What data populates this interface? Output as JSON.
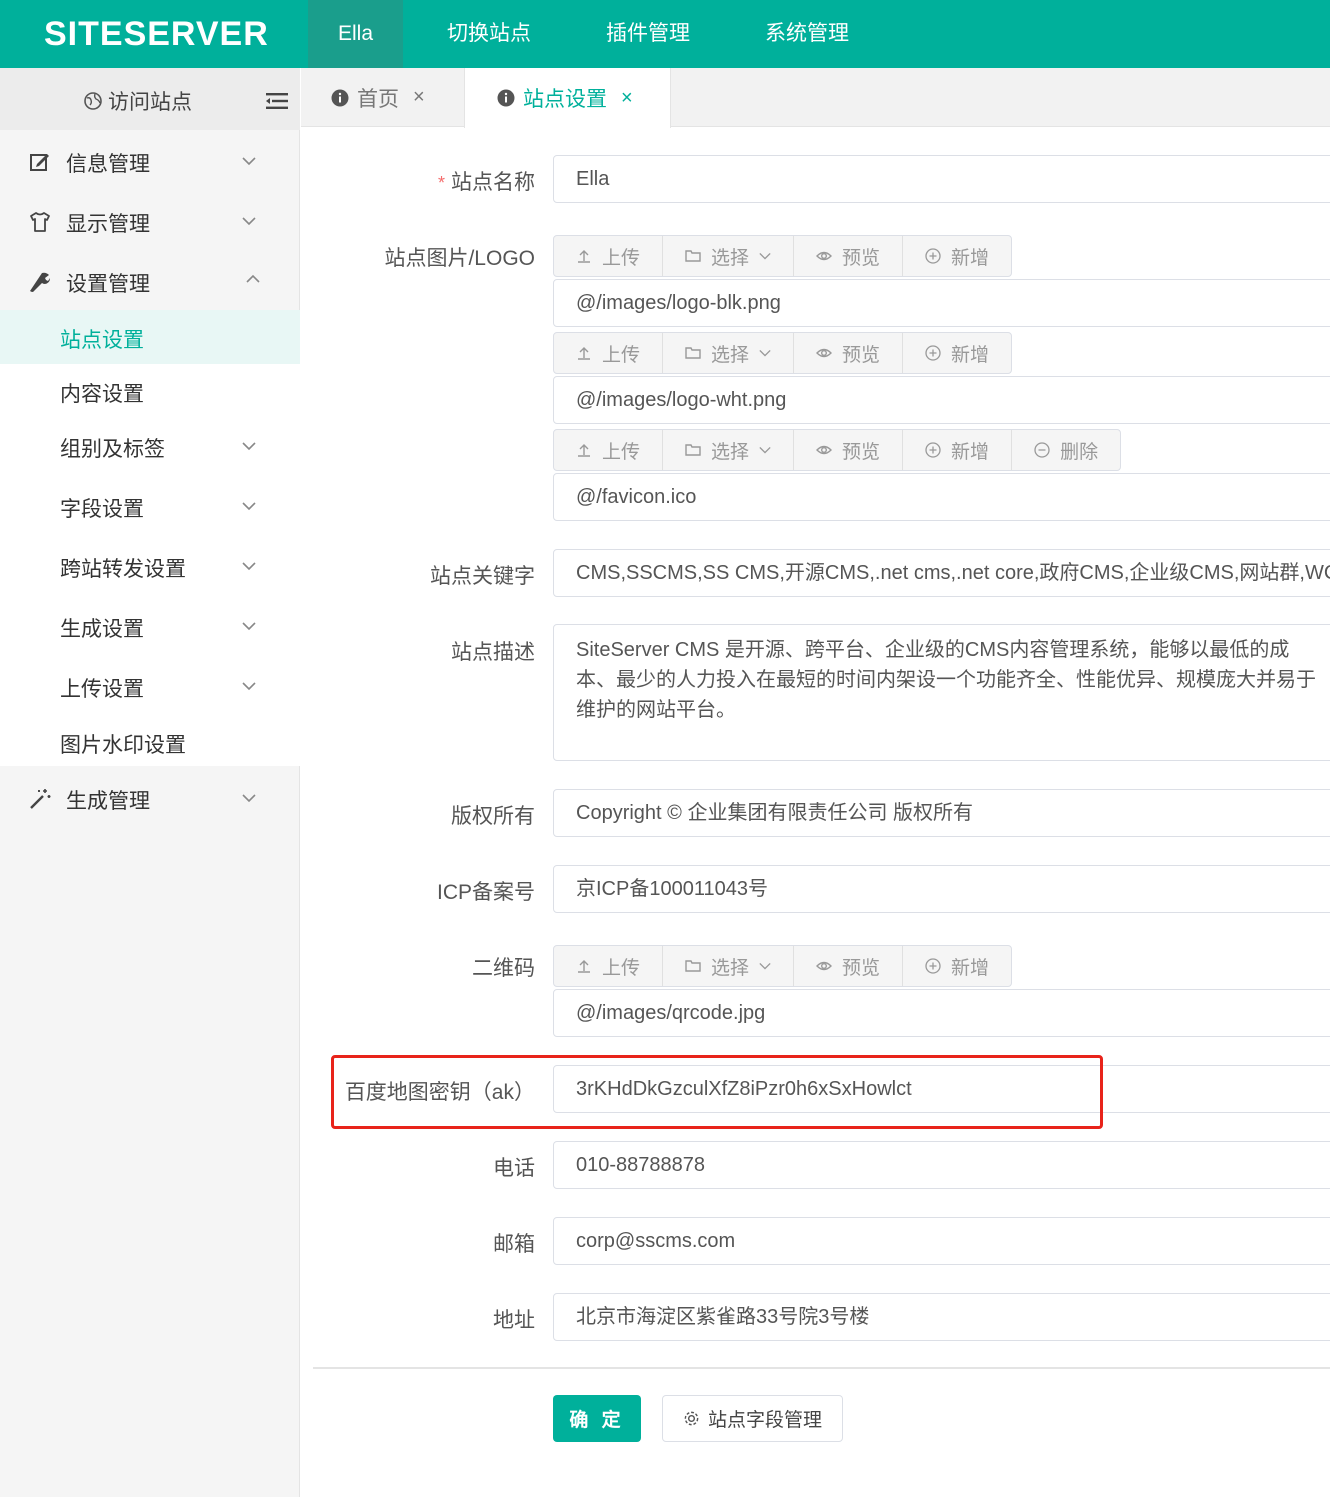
{
  "header": {
    "logo": "SITESERVER",
    "nav": [
      {
        "label": "Ella"
      },
      {
        "label": "切换站点"
      },
      {
        "label": "插件管理"
      },
      {
        "label": "系统管理"
      }
    ]
  },
  "sidebar": {
    "visit_label": "访问站点",
    "groups": [
      {
        "label": "信息管理",
        "icon": "edit-icon"
      },
      {
        "label": "显示管理",
        "icon": "shirt-icon"
      },
      {
        "label": "设置管理",
        "icon": "wrench-icon"
      },
      {
        "label": "生成管理",
        "icon": "magic-wand-icon"
      }
    ],
    "sub_items": [
      {
        "label": "站点设置"
      },
      {
        "label": "内容设置"
      },
      {
        "label": "组别及标签"
      },
      {
        "label": "字段设置"
      },
      {
        "label": "跨站转发设置"
      },
      {
        "label": "生成设置"
      },
      {
        "label": "上传设置"
      },
      {
        "label": "图片水印设置"
      }
    ]
  },
  "tabs": [
    {
      "label": "首页",
      "close": "×"
    },
    {
      "label": "站点设置",
      "close": "×"
    }
  ],
  "form": {
    "site_name": {
      "label": "站点名称",
      "required_mark": "*",
      "value": "Ella"
    },
    "logo": {
      "label": "站点图片/LOGO",
      "values": [
        "@/images/logo-blk.png",
        "@/images/logo-wht.png",
        "@/favicon.ico"
      ]
    },
    "buttons": {
      "upload": "上传",
      "select": "选择",
      "preview": "预览",
      "add": "新增",
      "delete": "删除"
    },
    "keywords": {
      "label": "站点关键字",
      "value": "CMS,SSCMS,SS CMS,开源CMS,.net cms,.net core,政府CMS,企业级CMS,网站群,WCM"
    },
    "description": {
      "label": "站点描述",
      "value": "SiteServer CMS 是开源、跨平台、企业级的CMS内容管理系统，能够以最低的成本、最少的人力投入在最短的时间内架设一个功能齐全、性能优异、规模庞大并易于维护的网站平台。"
    },
    "copyright": {
      "label": "版权所有",
      "value": "Copyright © 企业集团有限责任公司  版权所有"
    },
    "icp": {
      "label": "ICP备案号",
      "value": "京ICP备100011043号"
    },
    "qrcode": {
      "label": "二维码",
      "value": "@/images/qrcode.jpg"
    },
    "baidu_ak": {
      "label": "百度地图密钥（ak）",
      "value": "3rKHdDkGzculXfZ8iPzr0h6xSxHowlct"
    },
    "phone": {
      "label": "电话",
      "value": "010-88788878"
    },
    "email": {
      "label": "邮箱",
      "value": "corp@sscms.com"
    },
    "address": {
      "label": "地址",
      "value": "北京市海淀区紫雀路33号院3号楼"
    },
    "submit_label": "确 定",
    "fields_button_label": "站点字段管理"
  },
  "colors": {
    "brand": "#00b09b",
    "highlight": "#e8231a"
  }
}
